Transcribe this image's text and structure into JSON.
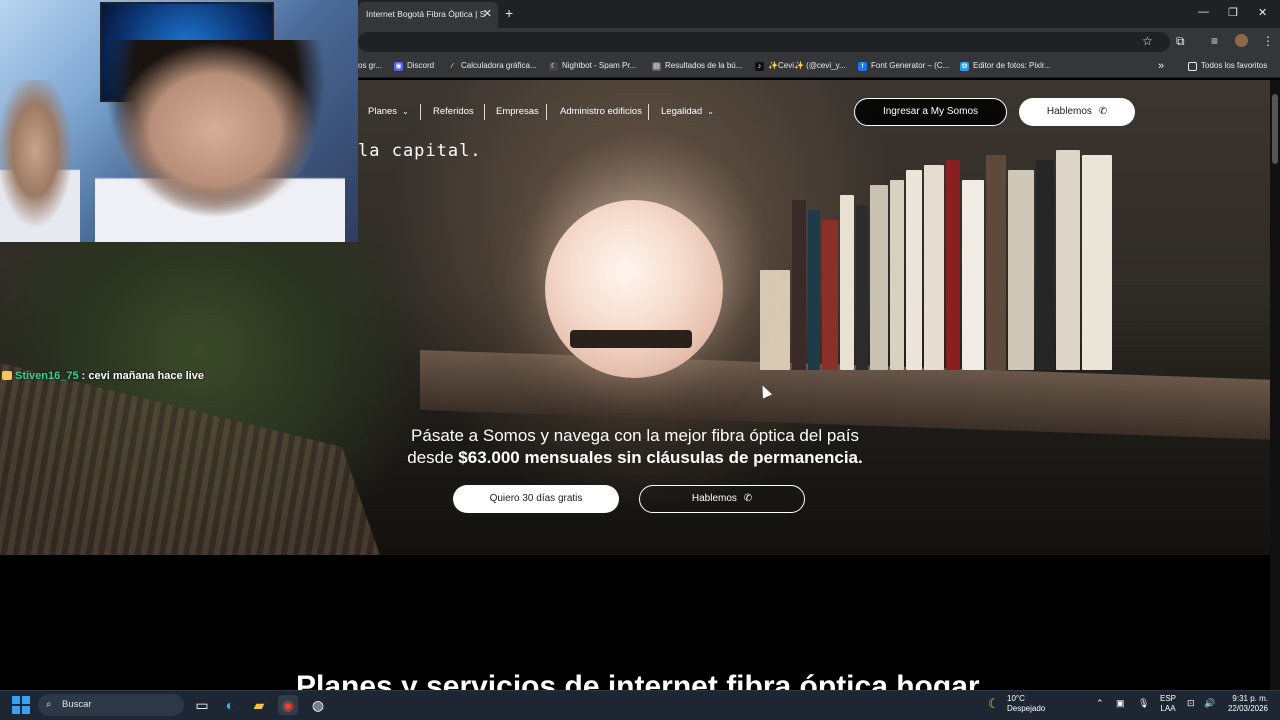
{
  "browser": {
    "tab_title": "Internet Bogotá Fibra Óptica | S",
    "tab_close": "✕",
    "new_tab": "+",
    "window_controls": [
      "—",
      "❐",
      "✕"
    ],
    "bookmarks": [
      {
        "label": "os gr...",
        "icon": "bookmark-icon"
      },
      {
        "label": "Discord",
        "icon": "discord-icon"
      },
      {
        "label": "Calculadora gráfica...",
        "icon": "desmos-icon"
      },
      {
        "label": "Nightbot - Spam Pr...",
        "icon": "nightbot-icon"
      },
      {
        "label": "Resultados de la bú...",
        "icon": "doc-icon"
      },
      {
        "label": "✨Cevi✨ (@cevi_y...",
        "icon": "tiktok-icon"
      },
      {
        "label": "Font Generator – (C...",
        "icon": "font-icon"
      },
      {
        "label": "Editor de fotos: Pixlr...",
        "icon": "pixlr-icon"
      }
    ],
    "bookmarks_more": "»",
    "all_favorites": "Todos los favoritos"
  },
  "nav": {
    "links": [
      "Planes",
      "Referidos",
      "Empresas",
      "Administro edificios",
      "Legalidad"
    ],
    "login_button": "Ingresar a My Somos",
    "talk_button": "Hablemos"
  },
  "hero": {
    "capital_text": "la capital.",
    "tagline_line1": "Pásate a Somos y navega con la mejor fibra óptica del país",
    "tagline_line2_pre": "desde ",
    "tagline_line2_bold": "$63.000 mensuales sin cláusulas de permanencia.",
    "cta_trial": "Quiero 30 días gratis",
    "cta_talk": "Hablemos"
  },
  "section": {
    "title": "Planes y servicios de internet fibra óptica hogar"
  },
  "stream": {
    "chat_user": "Stiven16_75",
    "chat_sep": " : ",
    "chat_message": "cevi mañana hace live"
  },
  "taskbar": {
    "search_placeholder": "Buscar",
    "weather_temp": "10°C",
    "weather_desc": "Despejado",
    "lang_1": "ESP",
    "lang_2": "LAA",
    "time": "9:31 p. m.",
    "date": "22/03/2026"
  }
}
